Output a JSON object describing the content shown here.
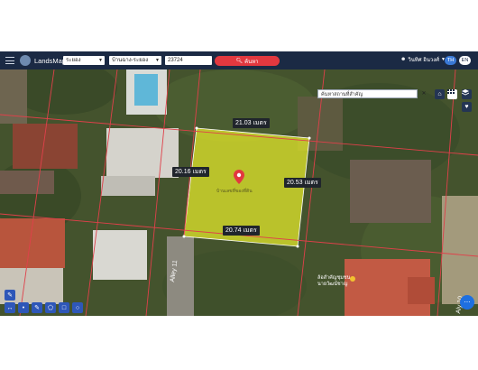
{
  "app": {
    "brand": "LandsMaps",
    "province": "ระยอง",
    "district": "บ้านฉาง-ระยอง",
    "parcel_no": "23724",
    "search_label": "ค้นหา",
    "user_name": "วินทิศ อินวงศ์",
    "lang_th": "TH",
    "lang_en": "EN"
  },
  "map": {
    "place_search_placeholder": "ค้นหาสถานที่สำคัญ",
    "pin_label": "บ้านเลขที่ของที่ดิน",
    "dimensions": {
      "top": "21.03 เมตร",
      "left": "20.16 เมตร",
      "right": "20.53 เมตร",
      "bottom": "20.74 เมตร"
    },
    "street_alley": "Alley 11",
    "street_right": "Aly 10",
    "poi_label": "ล้อสำคัญชุมชน\nนายวัฒน์ชาญ"
  },
  "colors": {
    "topbar": "#1b2a44",
    "parcel_fill": "#d8df2a",
    "boundary": "#e0404a",
    "accent_blue": "#1e6fe0",
    "search_red": "#e2383f"
  },
  "icons": [
    "menu-icon",
    "search-icon",
    "user-icon",
    "home-icon",
    "grid-icon",
    "layers-icon",
    "heart-icon",
    "pin-icon",
    "pencil-icon",
    "ruler-icon",
    "polygon-icon",
    "square-icon",
    "circle-icon",
    "fullscreen-icon",
    "more-icon"
  ]
}
